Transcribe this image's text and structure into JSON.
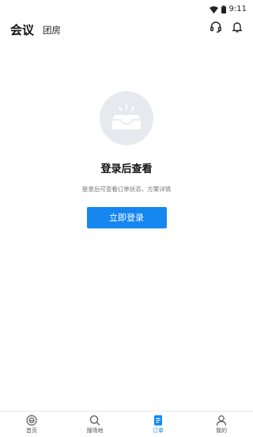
{
  "status_bar": {
    "time": "9:11",
    "icons": [
      "wifi-icon",
      "battery-icon"
    ]
  },
  "header": {
    "tabs": [
      {
        "label": "会议",
        "active": true
      },
      {
        "label": "团房",
        "active": false
      }
    ],
    "actions": [
      "headset-icon",
      "bell-icon"
    ]
  },
  "empty_state": {
    "icon": "inbox-icon",
    "title": "登录后查看",
    "subtitle": "登录后可查看订单状态，方案详情",
    "button_label": "立即登录"
  },
  "bottom_nav": {
    "active_color": "#1687ef",
    "items": [
      {
        "label": "首页",
        "icon": "home-icon",
        "active": false
      },
      {
        "label": "搜场地",
        "icon": "search-icon",
        "active": false
      },
      {
        "label": "订单",
        "icon": "order-icon",
        "active": true
      },
      {
        "label": "我的",
        "icon": "user-icon",
        "active": false
      }
    ]
  }
}
